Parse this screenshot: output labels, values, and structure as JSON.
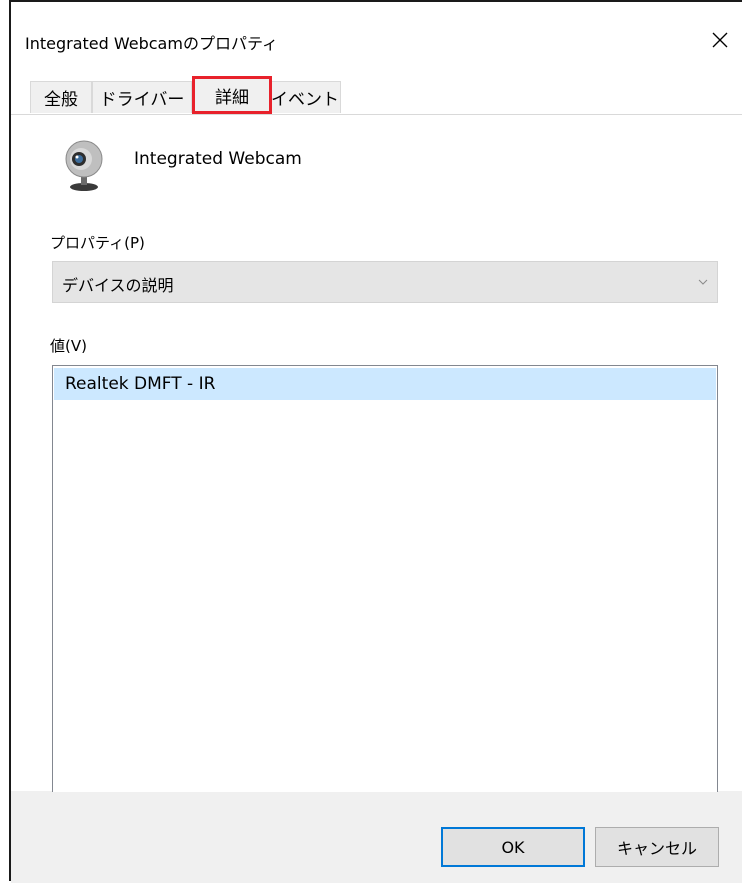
{
  "window": {
    "title": "Integrated Webcamのプロパティ"
  },
  "tabs": [
    {
      "label": "全般",
      "selected": false
    },
    {
      "label": "ドライバー",
      "selected": false
    },
    {
      "label": "詳細",
      "selected": true
    },
    {
      "label": "イベント",
      "selected": false
    }
  ],
  "device": {
    "name": "Integrated Webcam",
    "icon": "webcam-icon"
  },
  "property": {
    "label": "プロパティ(P)",
    "selected_value": "デバイスの説明"
  },
  "value": {
    "label": "値(V)",
    "items": [
      "Realtek DMFT - IR"
    ]
  },
  "buttons": {
    "ok": "OK",
    "cancel": "キャンセル"
  },
  "colors": {
    "selected_tab_highlight": "#e8212b",
    "list_selection": "#cce8ff",
    "default_button_border": "#0078d7"
  }
}
